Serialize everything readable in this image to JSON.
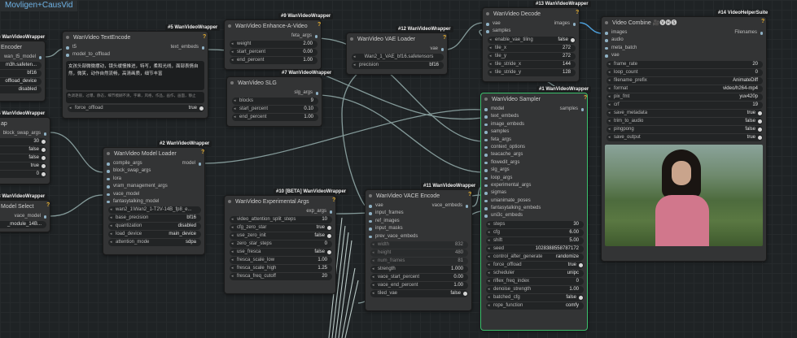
{
  "topbar": {
    "title": "Movligen+CausVid"
  },
  "nodes": {
    "text_encoder_left": {
      "title": "Encoder",
      "badge": "#6 WanVideoWrapper",
      "outputs": [
        "wan_t5_model"
      ],
      "values": [
        "m3h.safeten...",
        "bf16",
        "offload_device",
        "disabled"
      ]
    },
    "block_swap": {
      "title": "ap",
      "badge": "#4 WanVideoWrapper",
      "output": "block_swap_args",
      "values": [
        "30",
        "false",
        "false",
        "true",
        "0"
      ]
    },
    "model_select": {
      "title": "Model Select",
      "badge": "#3 WanVideoWrapper",
      "output": "vace_model",
      "value": "_module_14B..."
    },
    "text_encode": {
      "title": "WanVideo TextEncode",
      "badge": "#5 WanVideoWrapper",
      "inputs": [
        "t5",
        "model_to_offload"
      ],
      "output": "text_embeds",
      "prompt": "女孩头部微微摆动，镜头缓慢推进，特写，柔和光线，面部表情自然，微笑，动作自然流畅，高清画质，细节丰富",
      "negative": "色调艳丽，过曝，静态，细节模糊不清，字幕，风格，作品，画作，画面，静止",
      "force_offload_label": "force_offload",
      "force_offload": "true"
    },
    "enhance": {
      "title": "WanVideo Enhance-A-Video",
      "badge": "#9 WanVideoWrapper",
      "output": "feta_args",
      "rows": [
        {
          "k": "weight",
          "v": "2.00"
        },
        {
          "k": "start_percent",
          "v": "0.00"
        },
        {
          "k": "end_percent",
          "v": "1.00"
        }
      ]
    },
    "slg": {
      "title": "WanVideo SLG",
      "badge": "#7 WanVideoWrapper",
      "output": "slg_args",
      "rows": [
        {
          "k": "blocks",
          "v": "9"
        },
        {
          "k": "start_percent",
          "v": "0.10"
        },
        {
          "k": "end_percent",
          "v": "1.00"
        }
      ]
    },
    "vae_loader": {
      "title": "WanVideo VAE Loader",
      "badge": "#12 WanVideoWrapper",
      "output": "vae",
      "model": "Wan2_1_VAE_bf16.safetensors",
      "precision_label": "precision",
      "precision": "bf16"
    },
    "decode": {
      "title": "WanVideo Decode",
      "badge": "#13 WanVideoWrapper",
      "inputs": [
        "vae",
        "samples"
      ],
      "output": "images",
      "rows": [
        {
          "k": "enable_vae_tiling",
          "v": "false"
        },
        {
          "k": "tile_x",
          "v": "272"
        },
        {
          "k": "tile_y",
          "v": "272"
        },
        {
          "k": "tile_stride_x",
          "v": "144"
        },
        {
          "k": "tile_stride_y",
          "v": "128"
        }
      ]
    },
    "combine": {
      "title": "Video Combine 🎥🅥🅗🅢",
      "badge": "#14 VideoHelperSuite",
      "inputs": [
        "images",
        "audio",
        "meta_batch",
        "vae"
      ],
      "output": "Filenames",
      "rows": [
        {
          "k": "frame_rate",
          "v": "20"
        },
        {
          "k": "loop_count",
          "v": "0"
        },
        {
          "k": "filename_prefix",
          "v": "AnimateDiff"
        },
        {
          "k": "format",
          "v": "video/h264-mp4"
        },
        {
          "k": "pix_fmt",
          "v": "yuv420p"
        },
        {
          "k": "crf",
          "v": "19"
        },
        {
          "k": "save_metadata",
          "v": "true"
        },
        {
          "k": "trim_to_audio",
          "v": "false"
        },
        {
          "k": "pingpong",
          "v": "false"
        },
        {
          "k": "save_output",
          "v": "true"
        }
      ]
    },
    "model_loader": {
      "title": "WanVideo Model Loader",
      "badge": "#2 WanVideoWrapper",
      "inputs": [
        "compile_args",
        "block_swap_args",
        "lora",
        "vram_management_args",
        "vace_model",
        "fantasytalking_model"
      ],
      "output": "model",
      "rows": [
        {
          "k": "",
          "v": "wan2_1\\Wan2_1-T2V-14B_fp8_e..."
        },
        {
          "k": "base_precision",
          "v": "bf16"
        },
        {
          "k": "quantization",
          "v": "disabled"
        },
        {
          "k": "load_device",
          "v": "main_device"
        },
        {
          "k": "attention_mode",
          "v": "sdpa"
        }
      ]
    },
    "exp_args": {
      "title": "WanVideo Experimental Args",
      "badge": "#10 [BETA] WanVideoWrapper",
      "output": "exp_args",
      "rows": [
        {
          "k": "video_attention_split_steps",
          "v": "10"
        },
        {
          "k": "cfg_zero_star",
          "v": "true"
        },
        {
          "k": "use_zero_init",
          "v": "false"
        },
        {
          "k": "zero_star_steps",
          "v": "0"
        },
        {
          "k": "use_fresca",
          "v": "false"
        },
        {
          "k": "fresca_scale_low",
          "v": "1.00"
        },
        {
          "k": "fresca_scale_high",
          "v": "1.25"
        },
        {
          "k": "fresca_freq_cutoff",
          "v": "20"
        }
      ]
    },
    "vace_encode": {
      "title": "WanVideo VACE Encode",
      "badge": "#11 WanVideoWrapper",
      "inputs": [
        "vae",
        "input_frames",
        "ref_images",
        "input_masks",
        "prev_vace_embeds"
      ],
      "output": "vace_embeds",
      "rows": [
        {
          "k": "width",
          "v": "832"
        },
        {
          "k": "height",
          "v": "480"
        },
        {
          "k": "num_frames",
          "v": "81"
        },
        {
          "k": "strength",
          "v": "1.000"
        },
        {
          "k": "vace_start_percent",
          "v": "0.00"
        },
        {
          "k": "vace_end_percent",
          "v": "1.00"
        },
        {
          "k": "tiled_vae",
          "v": "false"
        }
      ]
    },
    "sampler": {
      "title": "WanVideo Sampler",
      "badge": "#1 WanVideoWrapper",
      "inputs": [
        "model",
        "text_embeds",
        "image_embeds",
        "samples",
        "feta_args",
        "context_options",
        "teacache_args",
        "flowedit_args",
        "slg_args",
        "loop_args",
        "experimental_args",
        "sigmas",
        "unianimate_poses",
        "fantasytalking_embeds",
        "uni3c_embeds"
      ],
      "output": "samples",
      "rows": [
        {
          "k": "steps",
          "v": "30"
        },
        {
          "k": "cfg",
          "v": "6.00"
        },
        {
          "k": "shift",
          "v": "5.00"
        },
        {
          "k": "seed",
          "v": "1028388558787172"
        },
        {
          "k": "control_after_generate",
          "v": "randomize"
        },
        {
          "k": "force_offload",
          "v": "true"
        },
        {
          "k": "scheduler",
          "v": "unipc"
        },
        {
          "k": "riflex_freq_index",
          "v": "0"
        },
        {
          "k": "denoise_strength",
          "v": "1.00"
        },
        {
          "k": "batched_cfg",
          "v": "false"
        },
        {
          "k": "rope_function",
          "v": "comfy"
        }
      ]
    }
  }
}
